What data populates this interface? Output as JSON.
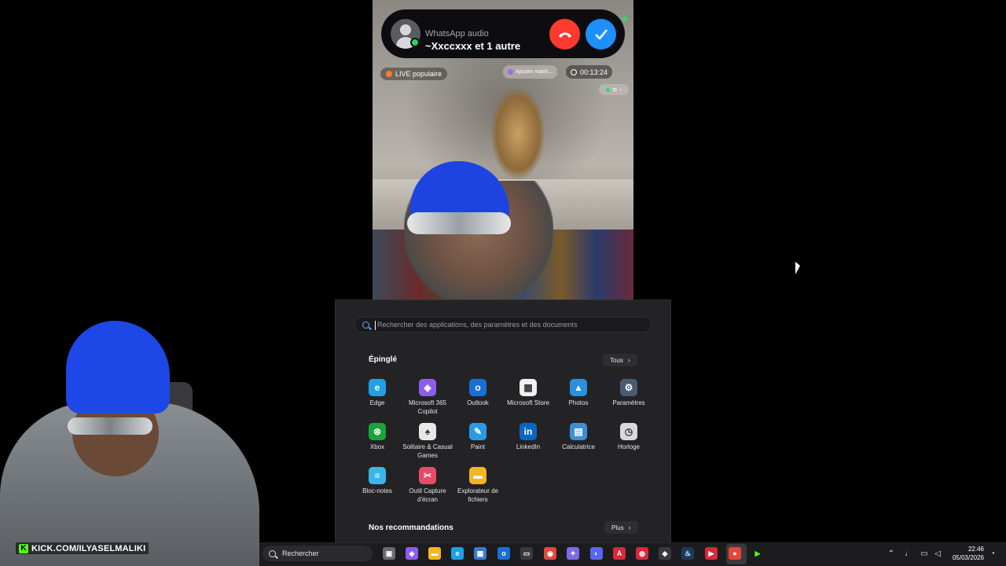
{
  "call": {
    "label": "WhatsApp audio",
    "name": "~Xxccxxx et 1 autre",
    "decline": "✆",
    "accept": "✓"
  },
  "stream_overlay": {
    "live_label": "LIVE populaire",
    "add_label": "Ajouter maint...",
    "timer": "00:13:24"
  },
  "start_menu": {
    "search_placeholder": "Rechercher des applications, des paramètres et des documents",
    "pinned_title": "Épinglé",
    "all_button": "Tous",
    "recommended_title": "Nos recommandations",
    "more_button": "Plus",
    "apps": [
      {
        "label": "Edge",
        "glyph": "e",
        "color": "#1fa0e6"
      },
      {
        "label": "Microsoft 365 Copilot",
        "glyph": "◈",
        "color": "#8c5cf0"
      },
      {
        "label": "Outlook",
        "glyph": "o",
        "color": "#1a6fd6"
      },
      {
        "label": "Microsoft Store",
        "glyph": "▦",
        "color": "#f0f0f0"
      },
      {
        "label": "Photos",
        "glyph": "▲",
        "color": "#2b8fe0"
      },
      {
        "label": "Paramètres",
        "glyph": "⚙",
        "color": "#4a5a74"
      },
      {
        "label": "Xbox",
        "glyph": "⊗",
        "color": "#19a33a"
      },
      {
        "label": "Solitaire & Casual Games",
        "glyph": "♠",
        "color": "#e8e8e8"
      },
      {
        "label": "Paint",
        "glyph": "✎",
        "color": "#2a9ae6"
      },
      {
        "label": "LinkedIn",
        "glyph": "in",
        "color": "#0a66c2"
      },
      {
        "label": "Calculatrice",
        "glyph": "▤",
        "color": "#3a8fd8"
      },
      {
        "label": "Horloge",
        "glyph": "◷",
        "color": "#d9d9dc"
      },
      {
        "label": "Bloc-notes",
        "glyph": "≡",
        "color": "#38b6e8"
      },
      {
        "label": "Outil Capture d'écran",
        "glyph": "✂",
        "color": "#e84a6a"
      },
      {
        "label": "Explorateur de fichiers",
        "glyph": "▬",
        "color": "#f3b521"
      }
    ]
  },
  "webcam": {
    "kick_text": "KICK.COM/ILYASELMALIKI"
  },
  "taskbar": {
    "search_label": "Rechercher",
    "time": "22:46",
    "date": "05/03/2026",
    "icons": [
      {
        "name": "task-view-icon",
        "glyph": "▣",
        "color": "#6a6a70"
      },
      {
        "name": "copilot-icon",
        "glyph": "◈",
        "color": "#8c5cf0"
      },
      {
        "name": "file-explorer-icon",
        "glyph": "▬",
        "color": "#f3b521"
      },
      {
        "name": "edge-icon",
        "glyph": "e",
        "color": "#1fa0e6"
      },
      {
        "name": "store-icon",
        "glyph": "▦",
        "color": "#3a7ad8"
      },
      {
        "name": "outlook-icon",
        "glyph": "o",
        "color": "#1a6fd6"
      },
      {
        "name": "capture-icon",
        "glyph": "▭",
        "color": "#3a3a3d"
      },
      {
        "name": "chrome-icon",
        "glyph": "◉",
        "color": "#e04a3a"
      },
      {
        "name": "game-controller-icon",
        "glyph": "✦",
        "color": "#7a6ae8"
      },
      {
        "name": "discord-icon",
        "glyph": "◐",
        "color": "#5865f2"
      },
      {
        "name": "acrobat-icon",
        "glyph": "A",
        "color": "#d8283a"
      },
      {
        "name": "app-red-icon",
        "glyph": "◍",
        "color": "#d8283a"
      },
      {
        "name": "app-dark-icon",
        "glyph": "◆",
        "color": "#3a3a3d"
      },
      {
        "name": "steam-icon",
        "glyph": "♨",
        "color": "#1b3a5a"
      },
      {
        "name": "video-app-icon",
        "glyph": "▶",
        "color": "#d8283a"
      },
      {
        "name": "recording-app-icon",
        "glyph": "●",
        "color": "#e8443a"
      },
      {
        "name": "kick-app-icon",
        "glyph": "▶",
        "color": "#1c1c1e"
      }
    ]
  }
}
